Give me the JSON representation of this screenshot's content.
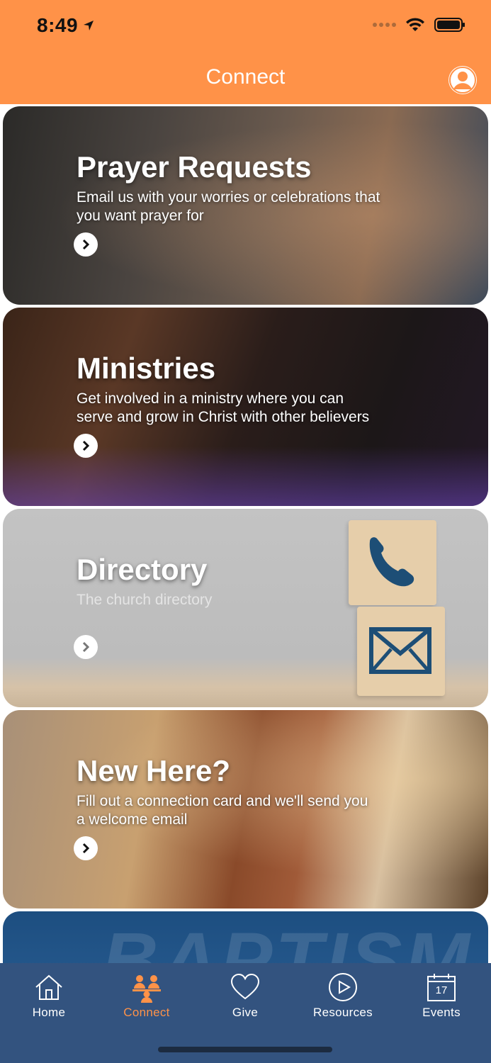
{
  "status": {
    "time": "8:49"
  },
  "header": {
    "title": "Connect"
  },
  "cards": [
    {
      "title": "Prayer Requests",
      "subtitle": "Email us with your worries or celebrations that you want prayer for"
    },
    {
      "title": "Ministries",
      "subtitle": "Get involved in a ministry where you can serve and grow in Christ with other believers"
    },
    {
      "title": "Directory",
      "subtitle": "The church directory"
    },
    {
      "title": "New Here?",
      "subtitle": "Fill out a connection card and we'll send you a welcome email"
    },
    {
      "title": "BAPTISM"
    }
  ],
  "tabs": [
    {
      "label": "Home",
      "icon": "home-icon"
    },
    {
      "label": "Connect",
      "icon": "connect-icon"
    },
    {
      "label": "Give",
      "icon": "heart-icon"
    },
    {
      "label": "Resources",
      "icon": "play-icon"
    },
    {
      "label": "Events",
      "icon": "calendar-icon",
      "badge": "17"
    }
  ],
  "colors": {
    "accent": "#ff9248",
    "tabbar": "#33537f",
    "white": "#ffffff"
  }
}
